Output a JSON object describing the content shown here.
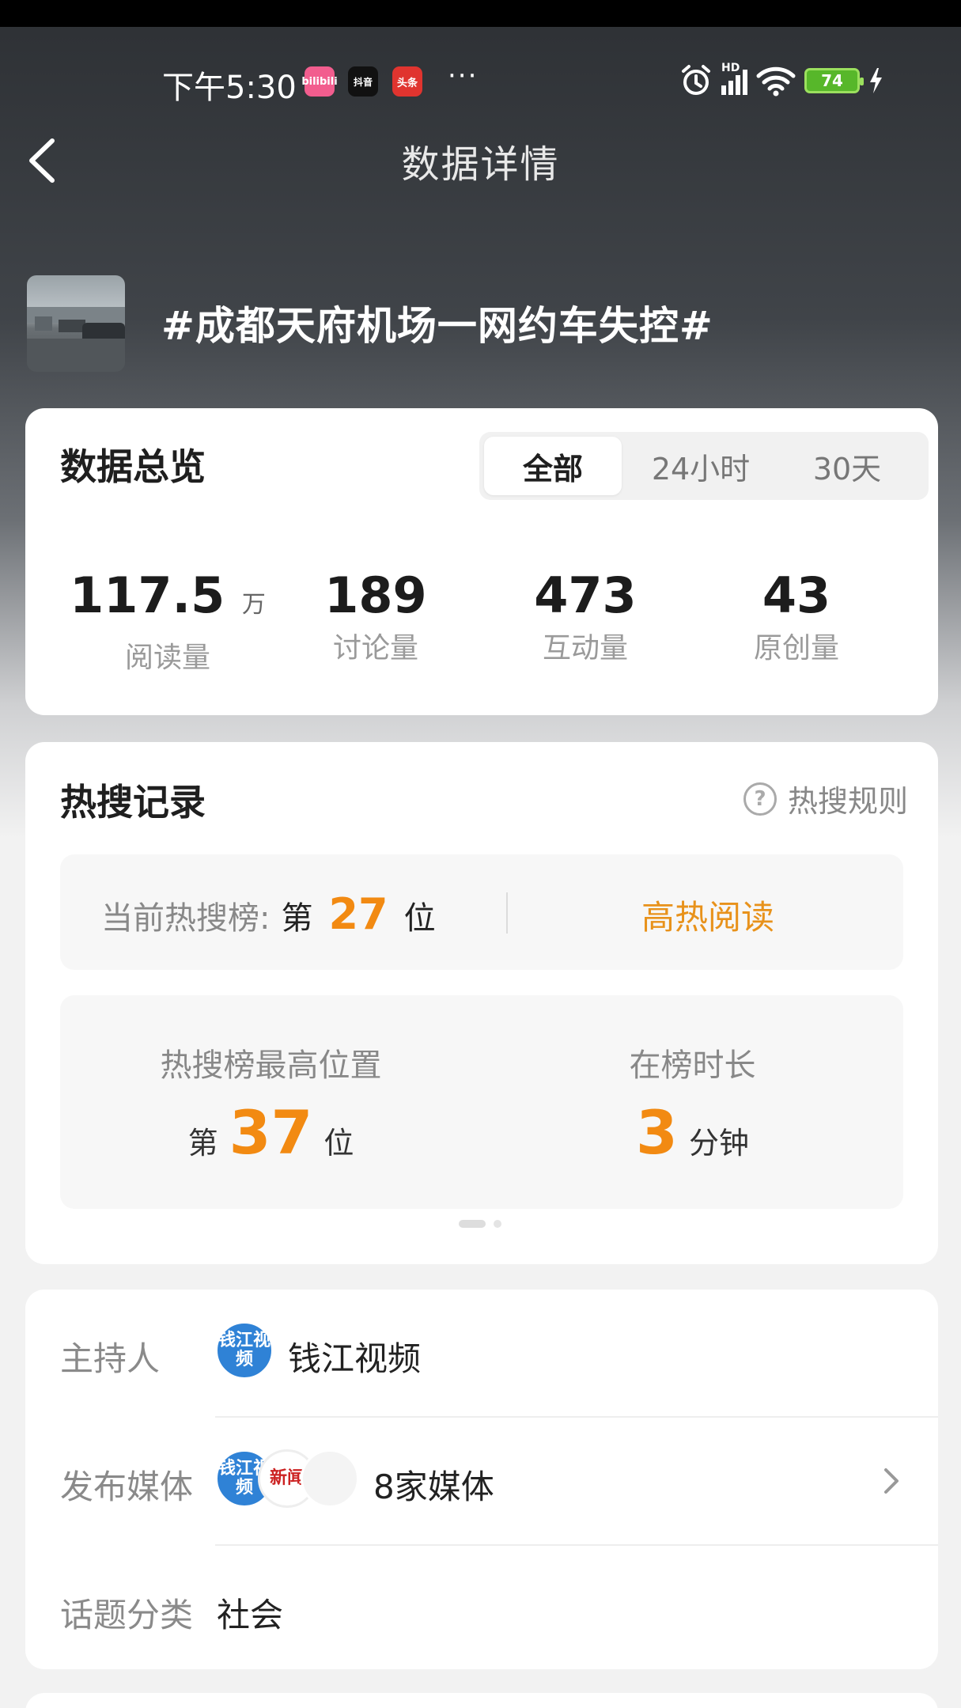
{
  "status_bar": {
    "time": "下午5:30",
    "apps": [
      "bilibili",
      "抖音",
      "头条"
    ],
    "more": "···",
    "network": "HD",
    "battery": "74"
  },
  "nav": {
    "title": "数据详情"
  },
  "topic": {
    "title": "#成都天府机场一网约车失控#"
  },
  "overview": {
    "title": "数据总览",
    "tabs": [
      "全部",
      "24小时",
      "30天"
    ],
    "active_tab": "全部",
    "stats": [
      {
        "value": "117.5",
        "unit": "万",
        "label": "阅读量"
      },
      {
        "value": "189",
        "unit": "",
        "label": "讨论量"
      },
      {
        "value": "473",
        "unit": "",
        "label": "互动量"
      },
      {
        "value": "43",
        "unit": "",
        "label": "原创量"
      }
    ]
  },
  "hot_search": {
    "title": "热搜记录",
    "rules_label": "热搜规则",
    "current": {
      "label": "当前热搜榜:",
      "prefix": "第",
      "rank": "27",
      "suffix": "位",
      "tag": "高热阅读"
    },
    "highest": {
      "label": "热搜榜最高位置",
      "prefix": "第",
      "rank": "37",
      "suffix": "位"
    },
    "duration": {
      "label": "在榜时长",
      "value": "3",
      "unit": "分钟"
    }
  },
  "info": {
    "host": {
      "key": "主持人",
      "avatar_text": "钱江视频",
      "name": "钱江视频"
    },
    "media": {
      "key": "发布媒体",
      "avatar_texts": [
        "钱江视频",
        "新闻"
      ],
      "value": "8家媒体"
    },
    "category": {
      "key": "话题分类",
      "value": "社会"
    }
  },
  "colors": {
    "accent_orange": "#f28a12",
    "hot_tag": "#e8921b",
    "avatar_blue": "#2f82d6",
    "battery_green": "#57b72a"
  }
}
